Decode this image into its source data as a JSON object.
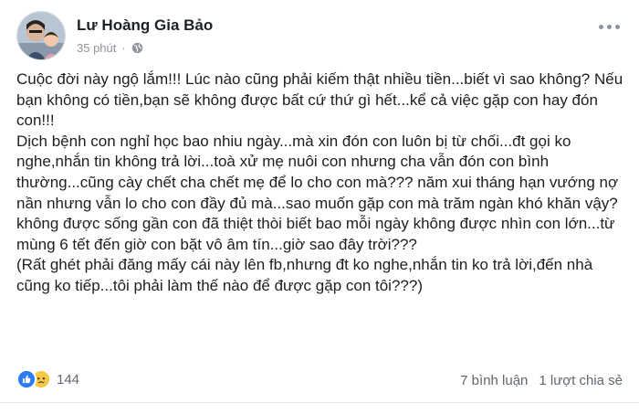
{
  "post": {
    "author": "Lư Hoàng Gia Bảo",
    "time": "35 phút",
    "body": [
      "Cuộc đời này ngộ lắm!!! Lúc nào cũng phải kiếm thật nhiều tiền...biết vì sao không? Nếu bạn không có tiền,bạn sẽ không được bất cứ thứ gì hết...kể cả việc gặp con hay đón con!!!",
      "Dịch bệnh con nghỉ học bao nhiu ngày...mà xin đón con luôn bị từ chối...đt gọi ko nghe,nhắn tin không trả lời...toà xử mẹ nuôi con nhưng cha vẫn đón con bình thường...cũng cày chết cha chết mẹ để lo cho con mà??? năm xui tháng hạn vướng nợ nần nhưng vẫn lo cho con đầy đủ mà...sao muốn gặp con mà trăm ngàn khó khăn vậy? không được sống gần con đã thiệt thòi biết bao mỗi ngày không được nhìn con lớn...từ mùng 6 tết đến giờ con bặt vô âm tín...giờ sao đây trời???",
      "(Rất ghét phải đăng mấy cái này lên fb,nhưng đt ko nghe,nhắn tin ko trả lời,đến nhà cũng ko tiếp...tôi phải làm thế nào để được gặp con tôi???)"
    ],
    "reaction_count": "144",
    "comments": "7 bình luận",
    "shares": "1 lượt chia sẻ"
  },
  "icons": {
    "privacy": "globe-icon",
    "more": "more-options-icon",
    "reactions": [
      "like-reaction-icon",
      "sad-reaction-icon"
    ]
  },
  "colors": {
    "like": "#2e7bf6",
    "sad": "#f7c844",
    "meta": "#90949c"
  }
}
